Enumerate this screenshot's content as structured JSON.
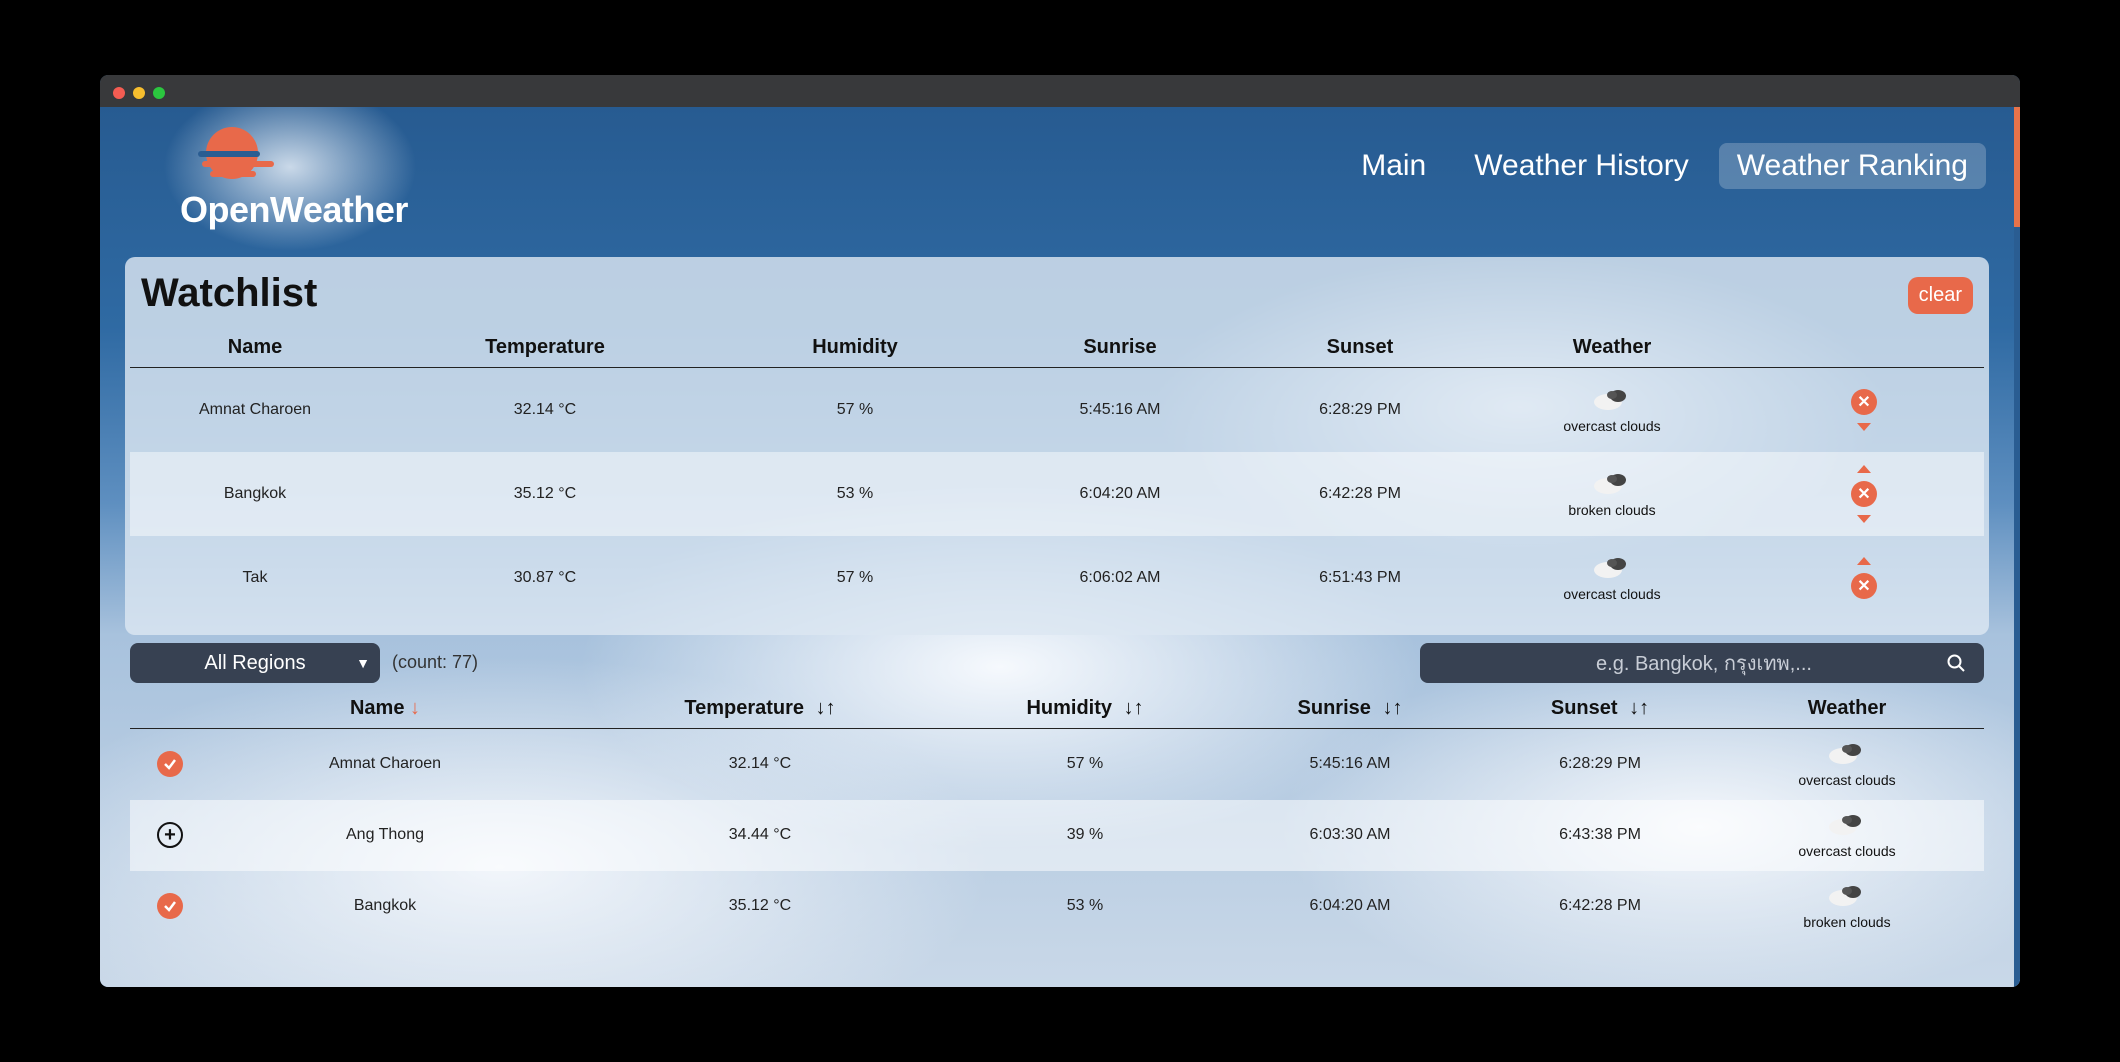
{
  "app": {
    "brand": "OpenWeather"
  },
  "nav": {
    "items": [
      {
        "label": "Main"
      },
      {
        "label": "Weather History"
      },
      {
        "label": "Weather Ranking"
      }
    ]
  },
  "watchlist": {
    "title": "Watchlist",
    "clear_label": "clear",
    "columns": [
      "Name",
      "Temperature",
      "Humidity",
      "Sunrise",
      "Sunset",
      "Weather"
    ],
    "rows": [
      {
        "name": "Amnat Charoen",
        "temperature": "32.14 °C",
        "humidity": "57 %",
        "sunrise": "5:45:16 AM",
        "sunset": "6:28:29 PM",
        "weather": "overcast clouds"
      },
      {
        "name": "Bangkok",
        "temperature": "35.12 °C",
        "humidity": "53 %",
        "sunrise": "6:04:20 AM",
        "sunset": "6:42:28 PM",
        "weather": "broken clouds"
      },
      {
        "name": "Tak",
        "temperature": "30.87 °C",
        "humidity": "57 %",
        "sunrise": "6:06:02 AM",
        "sunset": "6:51:43 PM",
        "weather": "overcast clouds"
      }
    ]
  },
  "filters": {
    "region_selected": "All Regions",
    "count_text": "(count: 77)",
    "search_placeholder": "e.g. Bangkok, กรุงเทพ,..."
  },
  "ranking": {
    "columns": [
      "Name",
      "Temperature",
      "Humidity",
      "Sunrise",
      "Sunset",
      "Weather"
    ],
    "rows": [
      {
        "name": "Amnat Charoen",
        "temperature": "32.14 °C",
        "humidity": "57 %",
        "sunrise": "5:45:16 AM",
        "sunset": "6:28:29 PM",
        "weather": "overcast clouds",
        "in_watchlist": true
      },
      {
        "name": "Ang Thong",
        "temperature": "34.44 °C",
        "humidity": "39 %",
        "sunrise": "6:03:30 AM",
        "sunset": "6:43:38 PM",
        "weather": "overcast clouds",
        "in_watchlist": false
      },
      {
        "name": "Bangkok",
        "temperature": "35.12 °C",
        "humidity": "53 %",
        "sunrise": "6:04:20 AM",
        "sunset": "6:42:28 PM",
        "weather": "broken clouds",
        "in_watchlist": true
      }
    ]
  },
  "colors": {
    "accent": "#e8694a",
    "dark": "#374152",
    "header_bg": "#2a5d92"
  }
}
